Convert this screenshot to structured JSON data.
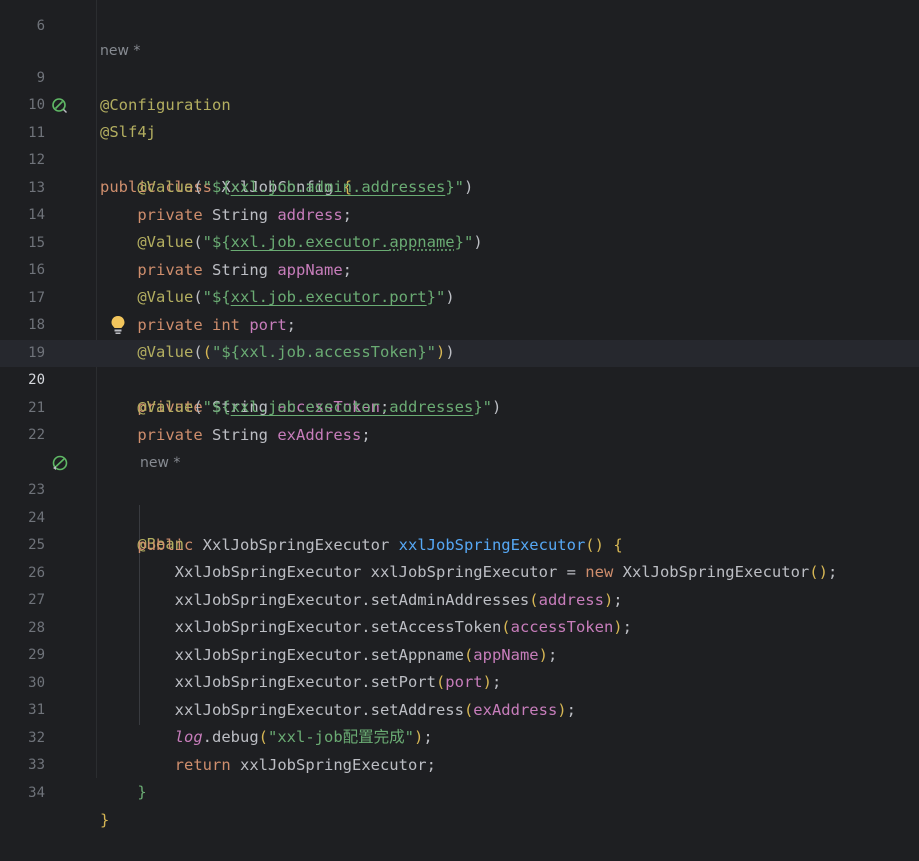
{
  "editor": {
    "hints": {
      "class_hint": "new *",
      "method_hint": "new *"
    },
    "lines": [
      {
        "n": "6"
      },
      {
        "n": "9"
      },
      {
        "n": "10"
      },
      {
        "n": "11"
      },
      {
        "n": "12"
      },
      {
        "n": "13"
      },
      {
        "n": "14"
      },
      {
        "n": "15"
      },
      {
        "n": "16"
      },
      {
        "n": "17"
      },
      {
        "n": "18"
      },
      {
        "n": "19"
      },
      {
        "n": "20"
      },
      {
        "n": "21"
      },
      {
        "n": "22"
      },
      {
        "n": "23"
      },
      {
        "n": "24"
      },
      {
        "n": "25"
      },
      {
        "n": "26"
      },
      {
        "n": "27"
      },
      {
        "n": "28"
      },
      {
        "n": "29"
      },
      {
        "n": "30"
      },
      {
        "n": "31"
      },
      {
        "n": "32"
      },
      {
        "n": "33"
      },
      {
        "n": "34"
      }
    ],
    "current_line": "20",
    "tokens": {
      "configuration": "@Configuration",
      "slf4j": "@Slf4j",
      "public": "public",
      "class": "class",
      "class_name": "XxlJobConfig",
      "lbrace": "{",
      "rbrace": "}",
      "value_ann": "@Value",
      "private": "private",
      "String": "String",
      "int": "int",
      "new": "new",
      "return": "return",
      "bean_ann": "@Bean",
      "admin_prefix": "\"${",
      "admin_key": "xxl.job.admin.addresses",
      "suffix": "}\"",
      "appname_key_a": "xxl.job.executor.",
      "appname_key_b": "appname",
      "port_key": "xxl.job.executor.port",
      "token_str": "\"${xxl.job.accessToken}\"",
      "addresses_key": "xxl.job.executor.addresses",
      "f_address": "address",
      "f_appName": "appName",
      "f_port": "port",
      "f_accessToken": "accessToken",
      "f_exAddress": "exAddress",
      "executor_type": "XxlJobSpringExecutor",
      "executor_method": "xxlJobSpringExecutor",
      "executor_var": "xxlJobSpringExecutor",
      "m_setAdminAddresses": ".setAdminAddresses",
      "m_setAccessToken": ".setAccessToken",
      "m_setAppname": ".setAppname",
      "m_setPort": ".setPort",
      "m_setAddress": ".setAddress",
      "log": "log",
      "debug": ".debug",
      "log_msg": "\"xxl-job配置完成\""
    }
  },
  "colors": {
    "background": "#1e1f22",
    "current_line": "#26282e",
    "annotation": "#b3ae60",
    "keyword": "#cf8e6d",
    "string": "#6aab73",
    "field": "#c77dbb",
    "method_decl": "#56a8f5",
    "bulb": "#f2c55c",
    "gutter_icon": "#5fb865"
  },
  "icons": [
    "bean-config-gutter-icon",
    "bean-method-gutter-icon",
    "intention-bulb-icon"
  ]
}
